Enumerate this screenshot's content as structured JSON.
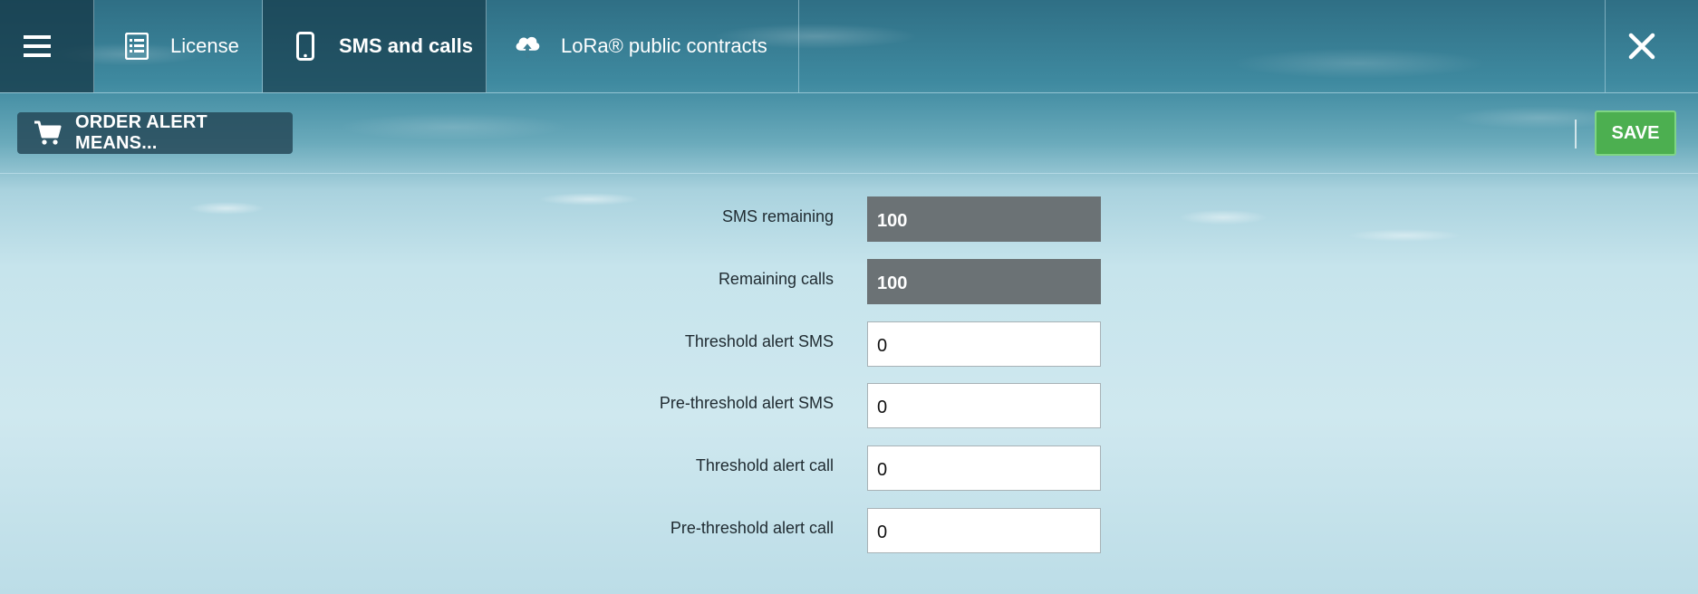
{
  "tabs": {
    "menu_icon": "hamburger-menu-icon",
    "license": {
      "label": "License",
      "icon": "list-document-icon"
    },
    "sms_calls": {
      "label": "SMS and calls",
      "icon": "mobile-phone-icon"
    },
    "lora": {
      "label": "LoRa® public contracts",
      "icon": "cloud-upload-icon"
    },
    "close_icon": "close-icon"
  },
  "toolbar": {
    "order_label": "ORDER ALERT MEANS...",
    "order_icon": "shopping-cart-icon",
    "save_label": "SAVE",
    "save_color": "#4caf50"
  },
  "form": {
    "fields": [
      {
        "label": "SMS remaining",
        "value": "100",
        "readonly": true
      },
      {
        "label": "Remaining calls",
        "value": "100",
        "readonly": true
      },
      {
        "label": "Threshold alert SMS",
        "value": "0",
        "readonly": false
      },
      {
        "label": "Pre-threshold alert SMS",
        "value": "0",
        "readonly": false
      },
      {
        "label": "Threshold alert call",
        "value": "0",
        "readonly": false
      },
      {
        "label": "Pre-threshold alert call",
        "value": "0",
        "readonly": false
      }
    ]
  }
}
